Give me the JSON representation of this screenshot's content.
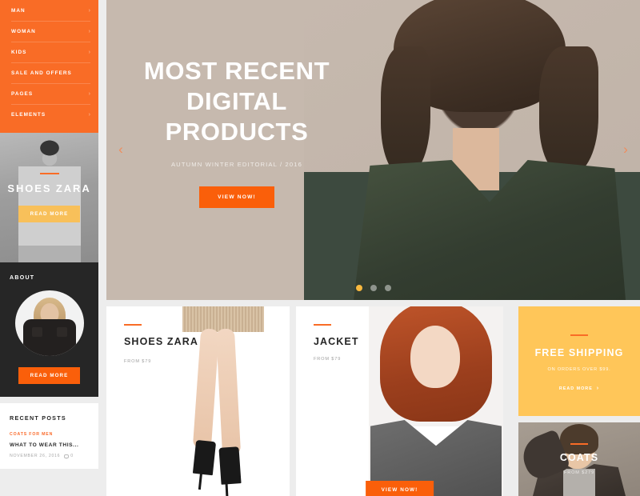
{
  "sidebar": {
    "nav": {
      "items": [
        {
          "label": "MAN",
          "chevron": true
        },
        {
          "label": "WOMAN",
          "chevron": true
        },
        {
          "label": "KIDS",
          "chevron": true
        },
        {
          "label": "SALE AND OFFERS",
          "chevron": false
        },
        {
          "label": "PAGES",
          "chevron": true
        },
        {
          "label": "ELEMENTS",
          "chevron": true
        }
      ]
    },
    "promo_shoes": {
      "title": "SHOES ZARA",
      "button": "READ MORE"
    },
    "about": {
      "title": "ABOUT",
      "button": "READ MORE"
    },
    "recent_posts": {
      "title": "RECENT POSTS",
      "posts": [
        {
          "category": "COATS FOR MEN",
          "title": "WHAT TO WEAR THIS...",
          "date": "NOVEMBER 26, 2016",
          "comments": "0"
        }
      ]
    }
  },
  "hero": {
    "heading": "MOST RECENT DIGITAL PRODUCTS",
    "subtitle": "AUTUMN WINTER EDITORIAL / 2016",
    "button": "VIEW NOW!",
    "prev_arrow": "‹",
    "next_arrow": "›",
    "slide_count": 3,
    "active_slide": 1
  },
  "grid": {
    "shoes": {
      "title": "SHOES ZARA",
      "price": "FROM $79"
    },
    "jacket": {
      "title": "JACKET",
      "price": "FROM $79",
      "button": "VIEW NOW!"
    },
    "shipping": {
      "title": "FREE SHIPPING",
      "subtitle": "ON ORDERS OVER $99.",
      "link": "READ MORE",
      "arrow": "›"
    },
    "coats": {
      "title": "COATS",
      "price": "FROM $279"
    }
  },
  "colors": {
    "orange": "#f96c26",
    "orange_button": "#fa5f0a",
    "yellow": "#ffc659",
    "yellow_button": "#f8c05a",
    "dark": "#262626",
    "page_bg": "#ededed",
    "hero_bg": "#c6b9ae"
  }
}
